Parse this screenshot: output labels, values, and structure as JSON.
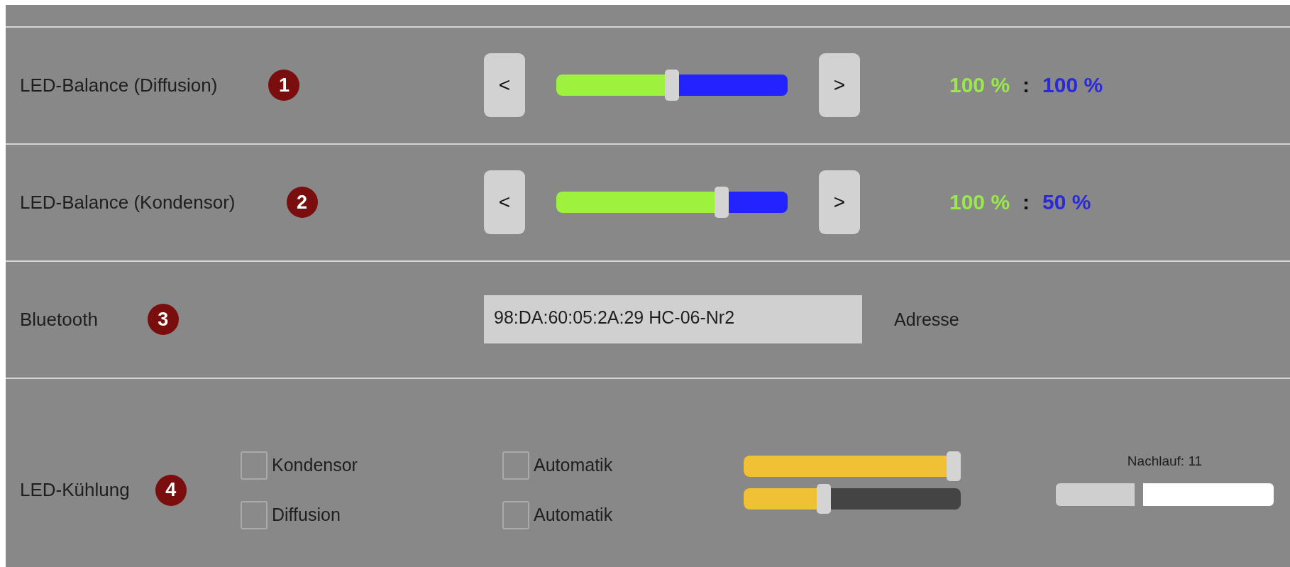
{
  "rows": [
    {
      "kind": "balance",
      "label": "LED-Balance (Diffusion)",
      "badge": "1",
      "decrease": "<",
      "increase": ">",
      "level": 0.5,
      "left_reading": "100 %",
      "separator": ":",
      "right_reading": "100 %"
    },
    {
      "kind": "balance",
      "label": "LED-Balance (Kondensor)",
      "badge": "2",
      "decrease": "<",
      "increase": ">",
      "level": 0.73,
      "left_reading": "100 %",
      "separator": ":",
      "right_reading": "50 %"
    },
    {
      "kind": "address",
      "label": "Bluetooth",
      "badge": "3",
      "value": "98:DA:60:05:2A:29 HC-06-Nr2",
      "caption": "Adresse"
    },
    {
      "kind": "cooling",
      "label": "LED-Kühlung",
      "badge": "4",
      "channels": [
        {
          "name": "Kondensor",
          "checked": false,
          "auto_label": "Automatik",
          "auto_checked": false,
          "level": 1
        },
        {
          "name": "Diffusion",
          "checked": false,
          "auto_label": "Automatik",
          "auto_checked": false,
          "level": 0.36
        }
      ],
      "runout": {
        "label": "Nachlauf: 11",
        "level": 0.38
      }
    }
  ]
}
